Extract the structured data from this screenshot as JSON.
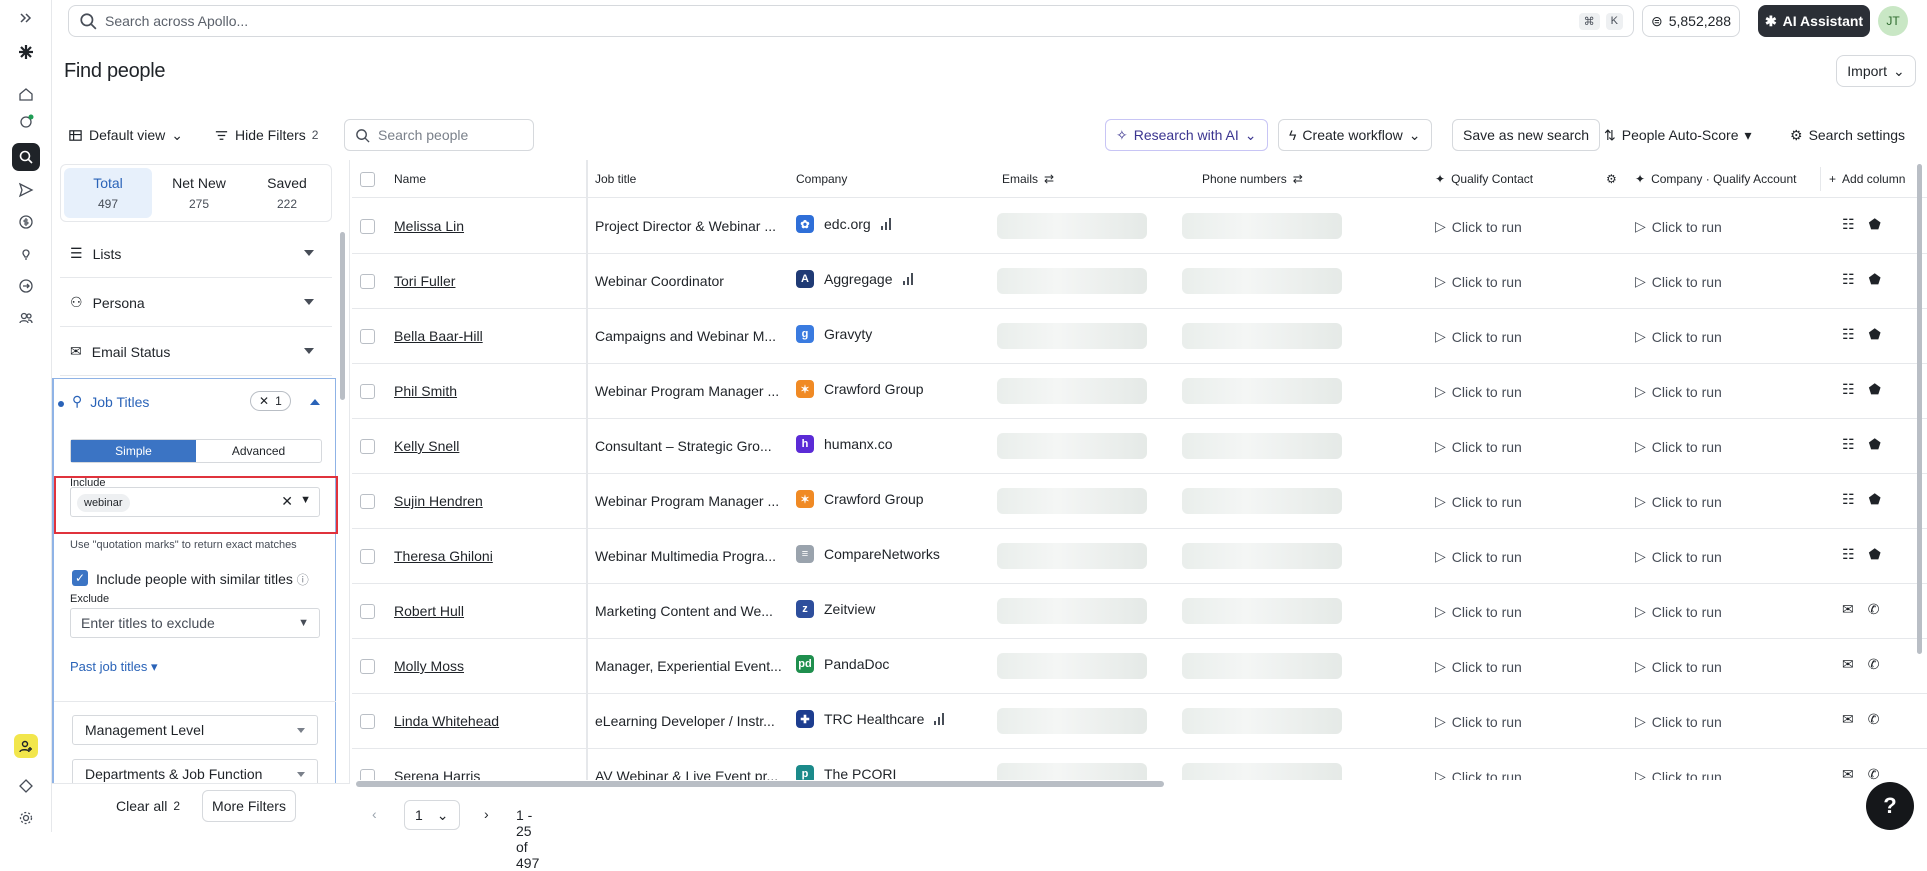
{
  "topbar": {
    "search_placeholder": "Search across Apollo...",
    "shortcut_keys": [
      "⌘",
      "K"
    ],
    "credits": "5,852,288",
    "ai_assistant_label": "AI Assistant",
    "avatar_initials": "JT"
  },
  "page": {
    "title": "Find people",
    "import_label": "Import"
  },
  "toolbar": {
    "default_view": "Default view",
    "hide_filters": "Hide Filters",
    "hide_filters_count": "2",
    "search_people_placeholder": "Search people",
    "research_ai": "Research with AI",
    "create_workflow": "Create workflow",
    "save_search": "Save as new search",
    "auto_score": "People Auto-Score",
    "search_settings": "Search settings"
  },
  "counts": [
    {
      "label": "Total",
      "value": "497"
    },
    {
      "label": "Net New",
      "value": "275"
    },
    {
      "label": "Saved",
      "value": "222"
    }
  ],
  "filters": {
    "sections": [
      "Lists",
      "Persona",
      "Email Status"
    ],
    "job_titles": {
      "label": "Job Titles",
      "count": "1",
      "mode_simple": "Simple",
      "mode_advanced": "Advanced",
      "include_label": "Include",
      "include_chip": "webinar",
      "hint": "Use \"quotation marks\" to return exact matches",
      "similar_label": "Include people with similar titles",
      "exclude_label": "Exclude",
      "exclude_placeholder": "Enter titles to exclude",
      "past_job_titles": "Past job titles"
    },
    "sub_filters": [
      "Management Level",
      "Departments & Job Function"
    ],
    "clear_all": "Clear all",
    "clear_count": "2",
    "more_filters": "More Filters"
  },
  "table": {
    "columns": [
      "Name",
      "Job title",
      "Company",
      "Emails",
      "Phone numbers",
      "Qualify Contact",
      "Company · Qualify Account",
      "Add column"
    ],
    "run_label": "Click to run",
    "rows": [
      {
        "name": "Melissa Lin",
        "job": "Project Director & Webinar ...",
        "company": "edc.org",
        "logo_color": "#2f6fd8",
        "logo_char": "✿",
        "bars": true
      },
      {
        "name": "Tori Fuller",
        "job": "Webinar Coordinator",
        "company": "Aggregage",
        "logo_color": "#1f3a75",
        "logo_char": "A",
        "bars": true
      },
      {
        "name": "Bella Baar-Hill",
        "job": "Campaigns and Webinar M...",
        "company": "Gravyty",
        "logo_color": "#3a7be0",
        "logo_char": "g",
        "bars": false
      },
      {
        "name": "Phil Smith",
        "job": "Webinar Program Manager ...",
        "company": "Crawford Group",
        "logo_color": "#f08a24",
        "logo_char": "✶",
        "bars": false
      },
      {
        "name": "Kelly Snell",
        "job": "Consultant – Strategic Gro...",
        "company": "humanx.co",
        "logo_color": "#5b2bd6",
        "logo_char": "h",
        "bars": false
      },
      {
        "name": "Sujin Hendren",
        "job": "Webinar Program Manager ...",
        "company": "Crawford Group",
        "logo_color": "#f08a24",
        "logo_char": "✶",
        "bars": false
      },
      {
        "name": "Theresa Ghiloni",
        "job": "Webinar Multimedia Progra...",
        "company": "CompareNetworks",
        "logo_color": "#9aa3ad",
        "logo_char": "≡",
        "bars": false
      },
      {
        "name": "Robert Hull",
        "job": "Marketing Content and We...",
        "company": "Zeitview",
        "logo_color": "#2d4e9c",
        "logo_char": "z",
        "bars": false
      },
      {
        "name": "Molly Moss",
        "job": "Manager, Experiential Event...",
        "company": "PandaDoc",
        "logo_color": "#1f8f4e",
        "logo_char": "pd",
        "bars": false
      },
      {
        "name": "Linda Whitehead",
        "job": "eLearning Developer / Instr...",
        "company": "TRC Healthcare",
        "logo_color": "#1d3d8f",
        "logo_char": "✚",
        "bars": true
      },
      {
        "name": "Serena Harris",
        "job": "AV Webinar & Live Event pr...",
        "company": "The PCORI",
        "logo_color": "#1b8a8a",
        "logo_char": "p",
        "bars": false
      }
    ]
  },
  "pager": {
    "page": "1",
    "range": "1 - 25 of 497"
  },
  "help_label": "?"
}
